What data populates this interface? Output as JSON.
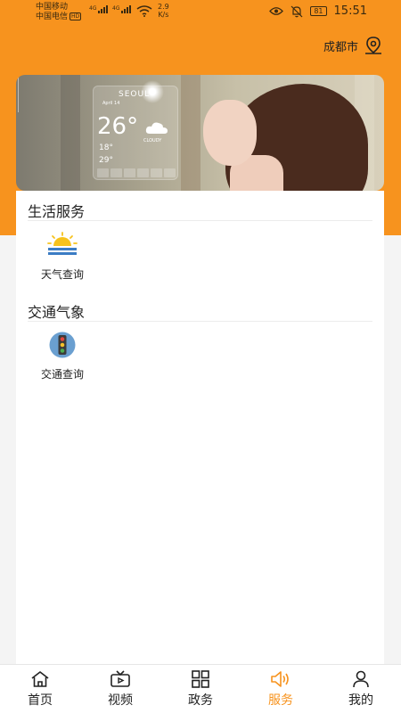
{
  "status_bar": {
    "carrier_1": "中国移动",
    "carrier_2": "中国电信",
    "hd_badge": "HD",
    "network_1": "4G",
    "network_2": "4G",
    "speed_value": "2.9",
    "speed_unit": "K/s",
    "battery": "81",
    "time": "15:51",
    "icons": [
      "eye-icon",
      "bell-off-icon",
      "wifi-icon",
      "signal-icon"
    ]
  },
  "header": {
    "location": "成都市",
    "location_icon": "map-pin-icon"
  },
  "banner": {
    "city": "SEOUL",
    "date": "April 14",
    "temperature": "26°",
    "condition": "CLOUDY",
    "low": "18°",
    "high": "29°"
  },
  "sections": [
    {
      "title": "生活服务",
      "items": [
        {
          "label": "天气查询",
          "icon": "sunrise-weather-icon"
        }
      ]
    },
    {
      "title": "交通气象",
      "items": [
        {
          "label": "交通查询",
          "icon": "traffic-light-icon"
        }
      ]
    }
  ],
  "bottom_nav": {
    "items": [
      {
        "label": "首页",
        "icon": "home-icon"
      },
      {
        "label": "视频",
        "icon": "tv-icon"
      },
      {
        "label": "政务",
        "icon": "grid-icon"
      },
      {
        "label": "服务",
        "icon": "speaker-icon"
      },
      {
        "label": "我的",
        "icon": "user-icon"
      }
    ],
    "active_index": 3
  },
  "colors": {
    "accent": "#f7931e",
    "background": "#f4f4f4",
    "card": "#ffffff"
  }
}
